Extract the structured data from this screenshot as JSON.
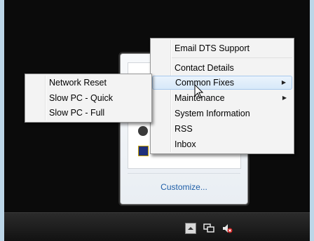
{
  "main_menu": {
    "items": [
      {
        "label": "Email DTS Support",
        "has_submenu": false
      },
      {
        "label": "Contact Details",
        "has_submenu": false
      },
      {
        "label": "Common Fixes",
        "has_submenu": true
      },
      {
        "label": "Maintenance",
        "has_submenu": true
      },
      {
        "label": "System Information",
        "has_submenu": false
      },
      {
        "label": "RSS",
        "has_submenu": false
      },
      {
        "label": "Inbox",
        "has_submenu": false
      }
    ],
    "highlighted": "Common Fixes"
  },
  "submenu": {
    "items": [
      {
        "label": "Network Reset"
      },
      {
        "label": "Slow PC - Quick"
      },
      {
        "label": "Slow PC - Full"
      }
    ]
  },
  "tray_flyout": {
    "customize_label": "Customize..."
  },
  "taskbar": {
    "icons": [
      "show-hidden-icons-icon",
      "network-icon",
      "volume-muted-icon"
    ]
  },
  "colors": {
    "desktop": "#0b0b0b",
    "menu_bg": "#f3f3f3",
    "highlight": "#d8e9f9",
    "link": "#1f5fa8"
  }
}
